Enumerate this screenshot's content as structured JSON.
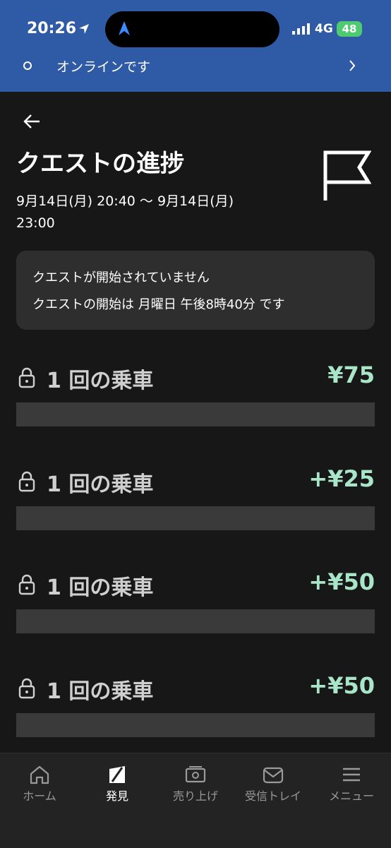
{
  "status_bar": {
    "time": "20:26",
    "network": "4G",
    "battery": "48",
    "icons": [
      "location-arrow-icon",
      "navigation-icon",
      "signal-icon",
      "battery-charging-icon"
    ]
  },
  "online_banner": {
    "label": "オンラインです",
    "icon": "status-dot-icon"
  },
  "header": {
    "title": "クエストの進捗",
    "range_line1": "9月14日(月) 20:40 〜 9月14日(月)",
    "range_line2": "23:00",
    "icon": "flag-icon"
  },
  "notice": {
    "line1": "クエストが開始されていません",
    "line2": "クエストの開始は 月曜日 午後8時40分 です"
  },
  "quests": [
    {
      "label": "1 回の乗車",
      "amount": "¥75",
      "locked": true
    },
    {
      "label": "1 回の乗車",
      "amount": "+¥25",
      "locked": true
    },
    {
      "label": "1 回の乗車",
      "amount": "+¥50",
      "locked": true
    },
    {
      "label": "1 回の乗車",
      "amount": "+¥50",
      "locked": true
    }
  ],
  "nav": [
    {
      "label": "ホーム",
      "icon": "home-icon",
      "active": false
    },
    {
      "label": "発見",
      "icon": "compass-icon",
      "active": true
    },
    {
      "label": "売り上げ",
      "icon": "cash-icon",
      "active": false
    },
    {
      "label": "受信トレイ",
      "icon": "mail-icon",
      "active": false
    },
    {
      "label": "メニュー",
      "icon": "menu-icon",
      "active": false
    }
  ],
  "colors": {
    "banner": "#2f5aa6",
    "background": "#171717",
    "amount": "#a9e6c9",
    "battery": "#4ecb71"
  }
}
